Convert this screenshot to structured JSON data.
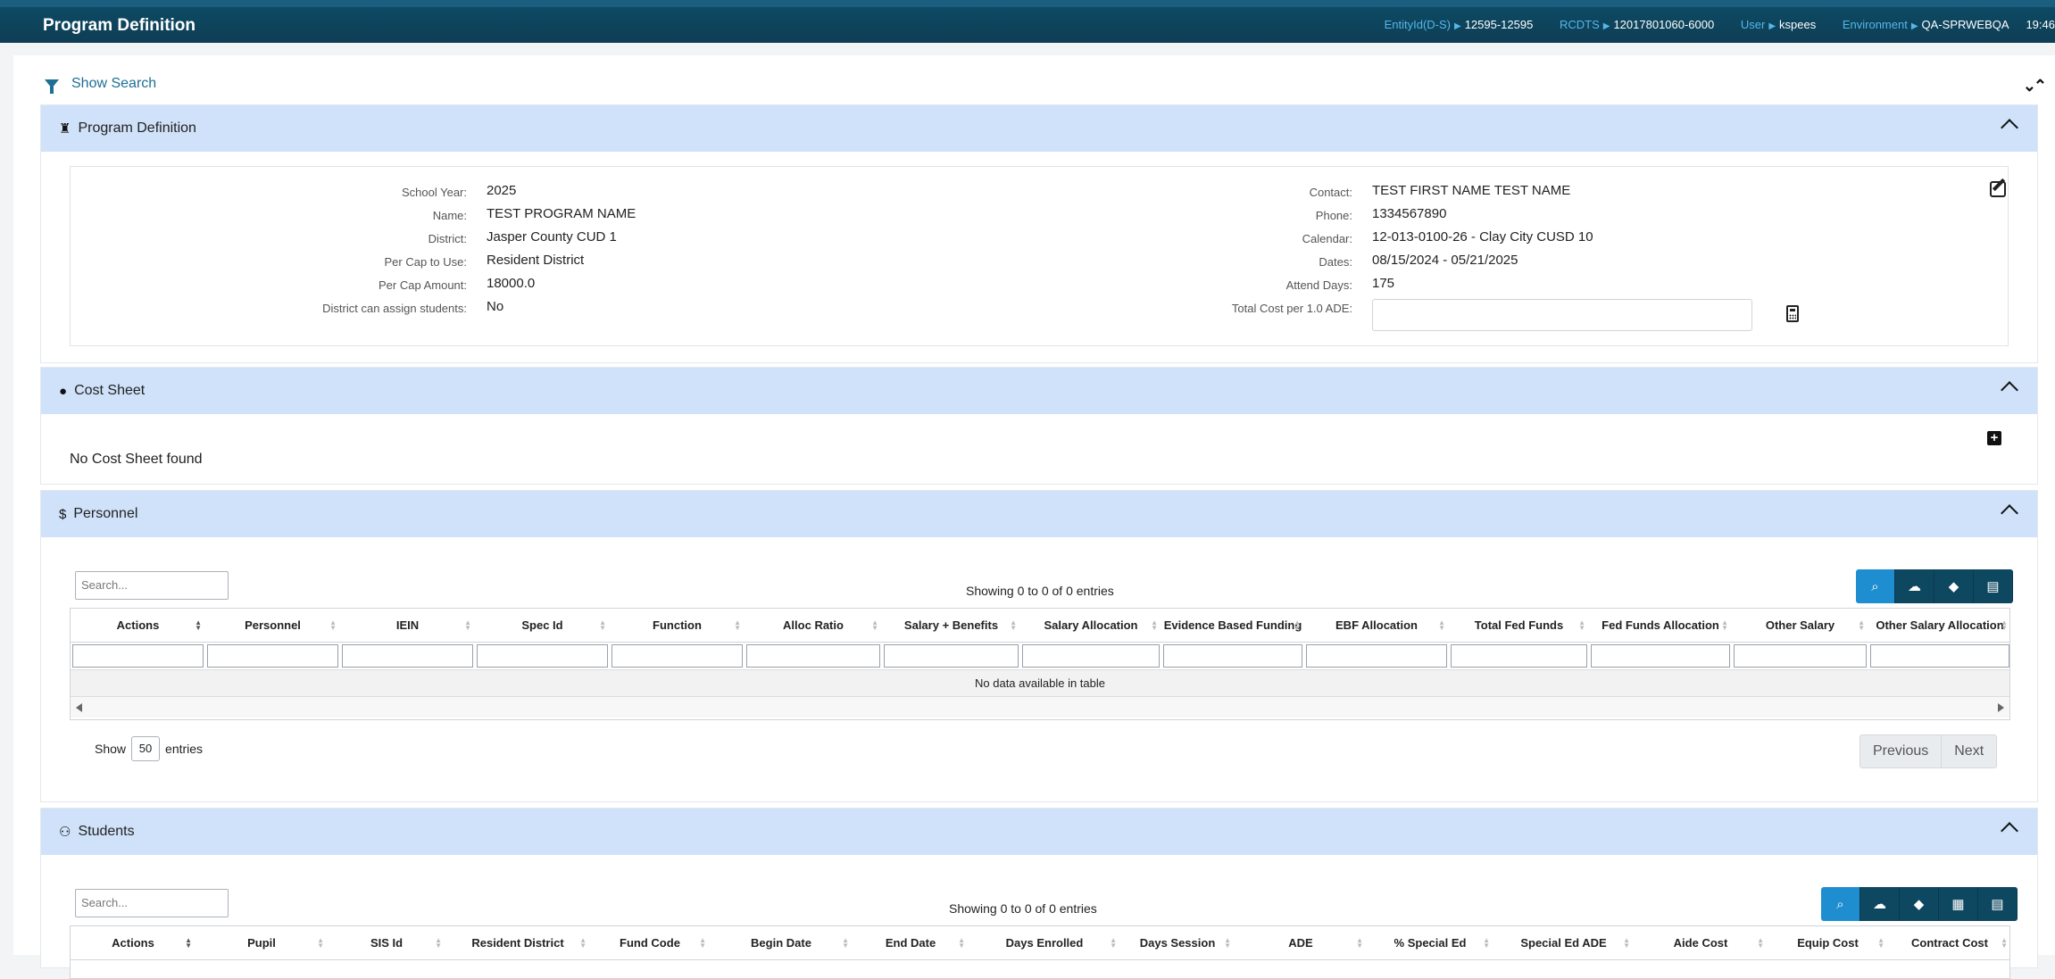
{
  "header": {
    "title": "Program Definition",
    "entity_label": "EntityId(D-S)",
    "entity_value": "12595-12595",
    "rcdts_label": "RCDTS",
    "rcdts_value": "12017801060-6000",
    "user_label": "User",
    "user_value": "kspees",
    "env_label": "Environment",
    "env_value": "QA-SPRWEBQA",
    "clock": "19:46"
  },
  "show_search": "Show Search",
  "program_definition": {
    "title": "Program Definition",
    "left": [
      {
        "label": "School Year:",
        "value": "2025"
      },
      {
        "label": "Name:",
        "value": "TEST PROGRAM NAME"
      },
      {
        "label": "District:",
        "value": "Jasper County CUD 1"
      },
      {
        "label": "Per Cap to Use:",
        "value": "Resident District"
      },
      {
        "label": "Per Cap Amount:",
        "value": "18000.0"
      },
      {
        "label": "District can assign students:",
        "value": "No"
      }
    ],
    "right": [
      {
        "label": "Contact:",
        "value": "TEST FIRST NAME TEST NAME"
      },
      {
        "label": "Phone:",
        "value": "1334567890"
      },
      {
        "label": "Calendar:",
        "value": "12-013-0100-26 - Clay City CUSD 10"
      },
      {
        "label": "Dates:",
        "value": "08/15/2024 - 05/21/2025"
      },
      {
        "label": "Attend Days:",
        "value": "175"
      },
      {
        "label": "Total Cost per 1.0 ADE:",
        "value": ""
      }
    ]
  },
  "cost_sheet": {
    "title": "Cost Sheet",
    "empty": "No Cost Sheet found"
  },
  "personnel": {
    "title": "Personnel",
    "search_placeholder": "Search...",
    "showing": "Showing 0 to 0 of 0 entries",
    "columns": [
      "Actions",
      "Personnel",
      "IEIN",
      "Spec Id",
      "Function",
      "Alloc Ratio",
      "Salary + Benefits",
      "Salary Allocation",
      "Evidence Based Funding",
      "EBF Allocation",
      "Total Fed Funds",
      "Fed Funds Allocation",
      "Other Salary",
      "Other Salary Allocation"
    ],
    "no_data": "No data available in table",
    "show_label": "Show",
    "page_length": "50",
    "entries_label": "entries",
    "prev": "Previous",
    "next": "Next"
  },
  "students": {
    "title": "Students",
    "search_placeholder": "Search...",
    "showing": "Showing 0 to 0 of 0 entries",
    "columns": [
      "Actions",
      "Pupil",
      "SIS Id",
      "Resident District",
      "Fund Code",
      "Begin Date",
      "End Date",
      "Days Enrolled",
      "Days Session",
      "ADE",
      "% Special Ed",
      "Special Ed ADE",
      "Aide Cost",
      "Equip Cost",
      "Contract Cost"
    ]
  }
}
